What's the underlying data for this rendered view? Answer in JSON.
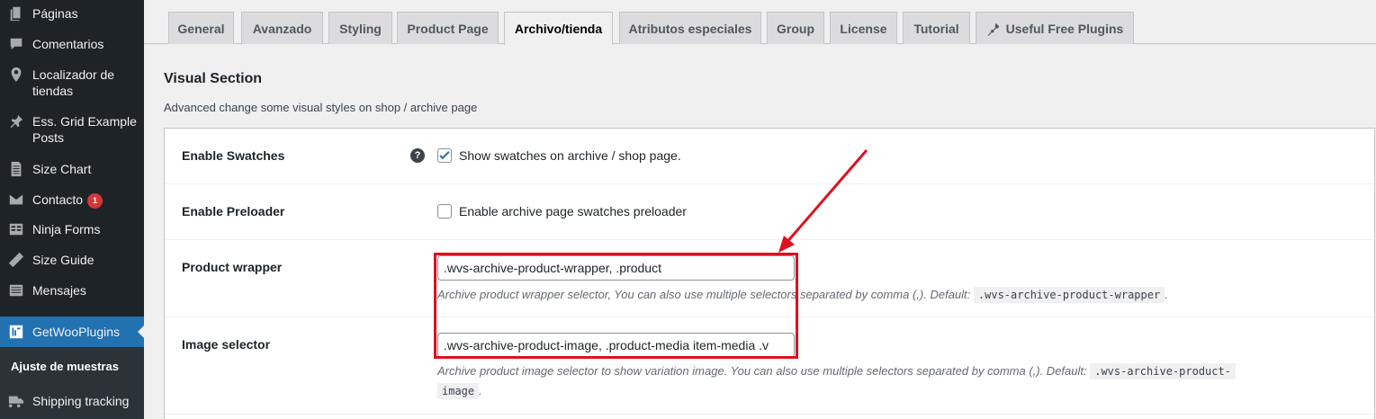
{
  "sidebar": {
    "items": [
      {
        "label": "Páginas",
        "icon": "pages-icon"
      },
      {
        "label": "Comentarios",
        "icon": "comments-icon"
      },
      {
        "label": "Localizador de tiendas",
        "icon": "location-pin-icon"
      },
      {
        "label": "Ess. Grid Example Posts",
        "icon": "pushpin-icon"
      },
      {
        "label": "Size Chart",
        "icon": "document-icon"
      },
      {
        "label": "Contacto",
        "icon": "mail-icon",
        "badge": "1"
      },
      {
        "label": "Ninja Forms",
        "icon": "forms-icon"
      },
      {
        "label": "Size Guide",
        "icon": "ruler-icon"
      },
      {
        "label": "Mensajes",
        "icon": "messages-icon"
      },
      {
        "label": "GetWooPlugins",
        "icon": "getwooplugins-icon",
        "current": true
      },
      {
        "label": "Shipping tracking",
        "icon": "truck-icon"
      }
    ],
    "submenu": {
      "label": "Ajuste de muestras"
    }
  },
  "tabs": [
    {
      "label": "General"
    },
    {
      "label": "Avanzado"
    },
    {
      "label": "Styling"
    },
    {
      "label": "Product Page"
    },
    {
      "label": "Archivo/tienda",
      "active": true
    },
    {
      "label": "Atributos especiales"
    },
    {
      "label": "Group"
    },
    {
      "label": "License"
    },
    {
      "label": "Tutorial"
    },
    {
      "label": "Useful Free Plugins",
      "icon": "plugin-icon"
    }
  ],
  "section": {
    "title": "Visual Section",
    "description": "Advanced change some visual styles on shop / archive page"
  },
  "settings": {
    "enable_swatches": {
      "label": "Enable Swatches",
      "checkbox_label": "Show swatches on archive / shop page.",
      "checked": true,
      "help": "?"
    },
    "enable_preloader": {
      "label": "Enable Preloader",
      "checkbox_label": "Enable archive page swatches preloader",
      "checked": false
    },
    "product_wrapper": {
      "label": "Product wrapper",
      "value": ".wvs-archive-product-wrapper, .product",
      "description": "Archive product wrapper selector, You can also use multiple selectors separated by comma (,). Default:",
      "default_code": ".wvs-archive-product-wrapper",
      "trailing": "."
    },
    "image_selector": {
      "label": "Image selector",
      "value": ".wvs-archive-product-image, .product-media item-media .v",
      "description": "Archive product image selector to show variation image. You can also use multiple selectors separated by comma (,). Default:",
      "default_code_line1": ".wvs-archive-product-",
      "default_code_line2": "image",
      "trailing": "."
    }
  },
  "colors": {
    "sidebar_bg": "#1d2327",
    "current_menu_bg": "#2271b1",
    "badge": "#d63638",
    "annotation_red": "#e0101e",
    "checkbox_check": "#2271b1"
  }
}
